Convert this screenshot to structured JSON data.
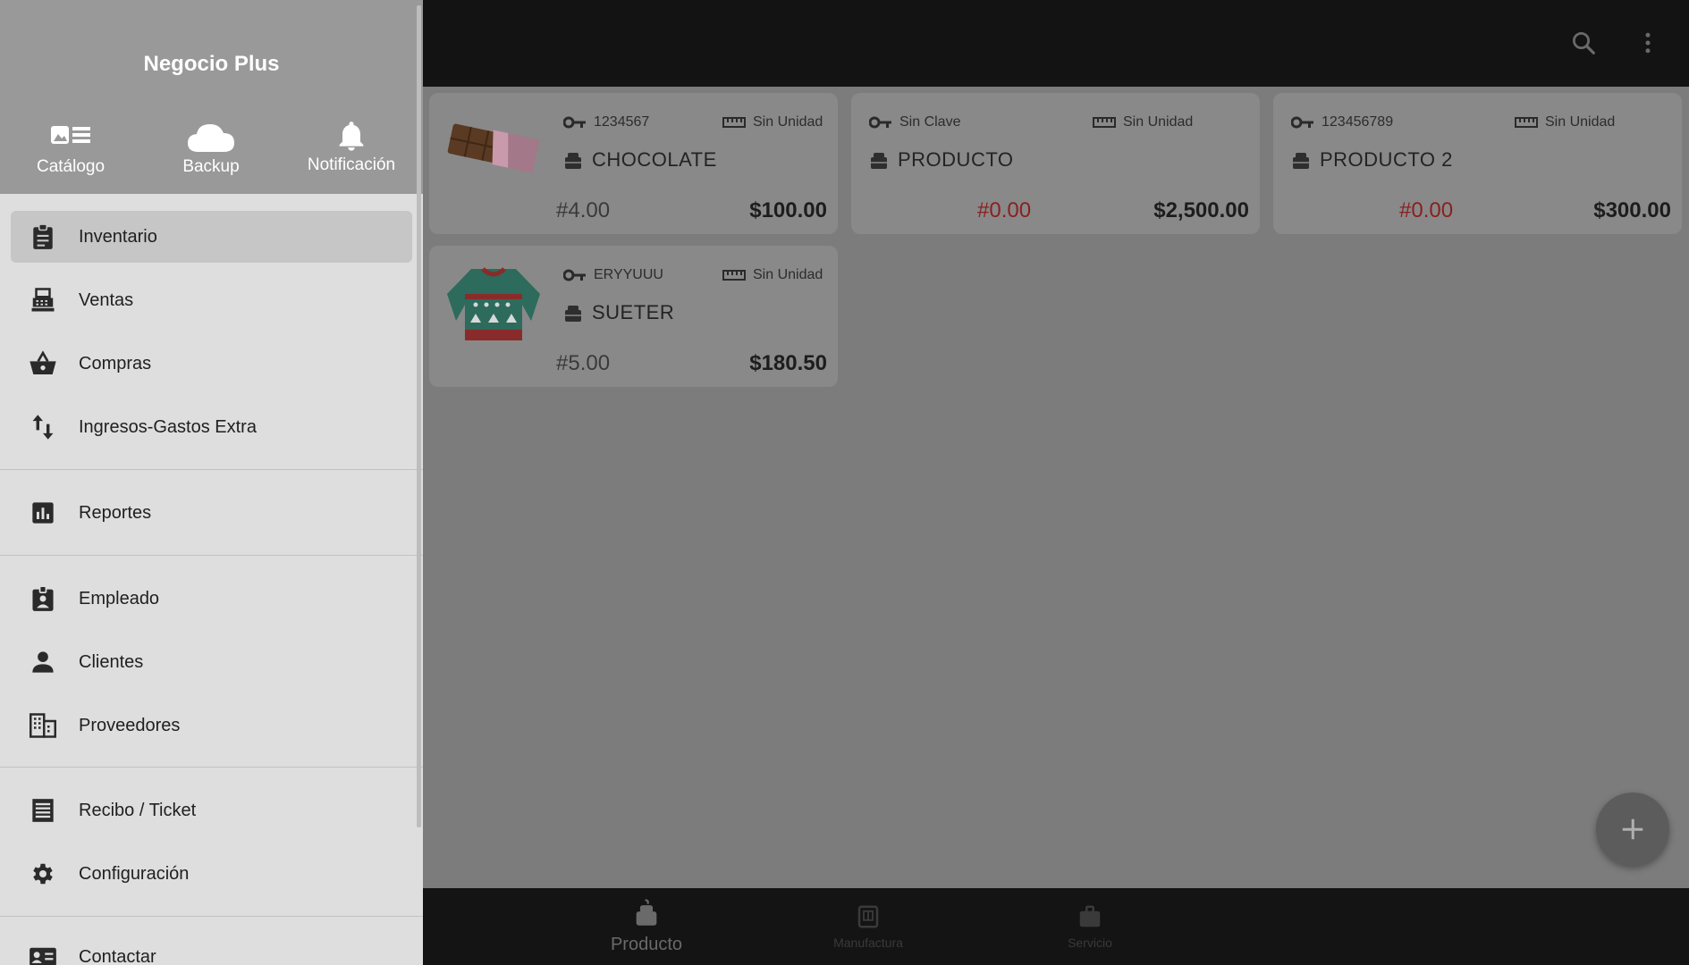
{
  "drawer": {
    "app_name": "Negocio Plus",
    "header_buttons": [
      {
        "label": "Catálogo",
        "icon": "catalog-icon"
      },
      {
        "label": "Backup",
        "icon": "cloud-icon"
      },
      {
        "label": "Notificación",
        "icon": "bell-icon"
      }
    ],
    "items": [
      {
        "label": "Inventario",
        "icon": "clipboard-icon",
        "active": true
      },
      {
        "label": "Ventas",
        "icon": "cash-register-icon"
      },
      {
        "label": "Compras",
        "icon": "basket-icon"
      },
      {
        "label": "Ingresos-Gastos Extra",
        "icon": "swap-vertical-icon"
      },
      {
        "label": "Reportes",
        "icon": "bar-chart-icon"
      },
      {
        "label": "Empleado",
        "icon": "badge-icon"
      },
      {
        "label": "Clientes",
        "icon": "person-icon"
      },
      {
        "label": "Proveedores",
        "icon": "building-icon"
      },
      {
        "label": "Recibo / Ticket",
        "icon": "receipt-icon"
      },
      {
        "label": "Configuración",
        "icon": "gear-icon"
      },
      {
        "label": "Contactar",
        "icon": "contact-card-icon"
      }
    ]
  },
  "toolbar": {
    "search_icon": "search-icon",
    "menu_icon": "more-vert-icon"
  },
  "products": [
    {
      "key": "1234567",
      "unit": "Sin Unidad",
      "name": "CHOCOLATE",
      "qty": "#4.00",
      "qty_negative": false,
      "price": "$100.00",
      "image": "chocolate-bar"
    },
    {
      "key": "Sin Clave",
      "unit": "Sin Unidad",
      "name": "PRODUCTO",
      "qty": "#0.00",
      "qty_negative": true,
      "price": "$2,500.00",
      "image": ""
    },
    {
      "key": "123456789",
      "unit": "Sin Unidad",
      "name": "PRODUCTO 2",
      "qty": "#0.00",
      "qty_negative": true,
      "price": "$300.00",
      "image": ""
    },
    {
      "key": "ERYYUUU",
      "unit": "Sin Unidad",
      "name": "SUETER",
      "qty": "#5.00",
      "qty_negative": false,
      "price": "$180.50",
      "image": "sweater"
    }
  ],
  "bottom_nav": [
    {
      "label": "Producto",
      "icon": "product-icon",
      "active": true
    },
    {
      "label": "Manufactura",
      "icon": "manufacture-icon",
      "active": false
    },
    {
      "label": "Servicio",
      "icon": "briefcase-icon",
      "active": false
    }
  ],
  "colors": {
    "drawer_header": "#999999",
    "drawer_body": "#dedede",
    "active_item": "#c6c6c6",
    "negative_qty": "#8a2020",
    "scrim": "#7c7c7c"
  }
}
